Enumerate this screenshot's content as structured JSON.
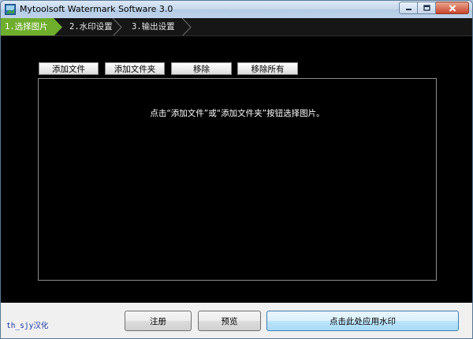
{
  "window": {
    "title": "Mytoolsoft Watermark Software 3.0"
  },
  "wizard": {
    "steps": [
      {
        "label": "1.选择图片",
        "active": true
      },
      {
        "label": "2.水印设置",
        "active": false
      },
      {
        "label": "3.输出设置",
        "active": false
      }
    ]
  },
  "toolbar": {
    "add_file": "添加文件",
    "add_folder": "添加文件夹",
    "remove": "移除",
    "remove_all": "移除所有"
  },
  "file_list": {
    "hint": "点击“添加文件”或“添加文件夹”按钮选择图片。"
  },
  "footer": {
    "credit": "th_sjy汉化",
    "register": "注册",
    "preview": "预览",
    "apply": "点击此处应用水印"
  },
  "colors": {
    "accent_green": "#6fae2c",
    "content_bg": "#000000",
    "wizard_bg": "#161616",
    "credit_text": "#1a33a6"
  },
  "icons": {
    "app": "watermark-app-icon",
    "minimize": "minimize-icon",
    "maximize": "maximize-icon",
    "close": "close-icon"
  }
}
